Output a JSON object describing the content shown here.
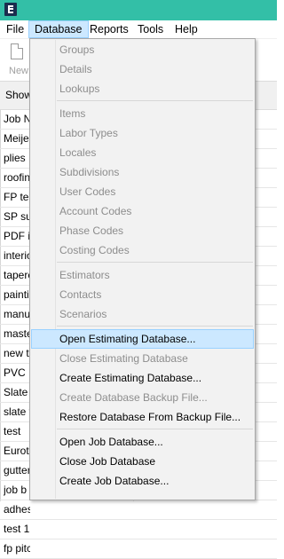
{
  "menubar": {
    "items": [
      "File",
      "Database",
      "Reports",
      "Tools",
      "Help"
    ]
  },
  "toolbar": {
    "new_label": "New"
  },
  "filterbar": {
    "show_label": "Show"
  },
  "grid": {
    "rows": [
      "Job N",
      "Meijer",
      "plies",
      "roofing",
      "FP tes",
      "SP sur",
      "PDF in",
      "interio",
      "tapere",
      "paintin",
      "manua",
      "maste",
      "new ti",
      "PVC",
      "Slate",
      "slate t",
      "test",
      "Eurote",
      "gutter",
      "job b",
      "adhes",
      "test 1",
      "fp pitc"
    ]
  },
  "dropdown": {
    "items": [
      {
        "label": "Groups",
        "enabled": false
      },
      {
        "label": "Details",
        "enabled": false
      },
      {
        "label": "Lookups",
        "enabled": false
      },
      {
        "label": "Items",
        "enabled": false
      },
      {
        "label": "Labor Types",
        "enabled": false
      },
      {
        "label": "Locales",
        "enabled": false
      },
      {
        "label": "Subdivisions",
        "enabled": false
      },
      {
        "label": "User Codes",
        "enabled": false
      },
      {
        "label": "Account Codes",
        "enabled": false
      },
      {
        "label": "Phase Codes",
        "enabled": false
      },
      {
        "label": "Costing Codes",
        "enabled": false
      },
      {
        "label": "Estimators",
        "enabled": false
      },
      {
        "label": "Contacts",
        "enabled": false
      },
      {
        "label": "Scenarios",
        "enabled": false
      },
      {
        "label": "Open Estimating Database...",
        "enabled": true,
        "highlighted": true
      },
      {
        "label": "Close Estimating Database",
        "enabled": false
      },
      {
        "label": "Create Estimating Database...",
        "enabled": true
      },
      {
        "label": "Create Database Backup File...",
        "enabled": false
      },
      {
        "label": "Restore Database From Backup File...",
        "enabled": true
      },
      {
        "label": "Open Job Database...",
        "enabled": true
      },
      {
        "label": "Close Job Database",
        "enabled": true
      },
      {
        "label": "Create Job Database...",
        "enabled": true
      }
    ]
  },
  "colors": {
    "titlebar": "#33bfa7",
    "menu_highlight": "#cce8ff",
    "disabled_text": "#8d8d8d"
  }
}
